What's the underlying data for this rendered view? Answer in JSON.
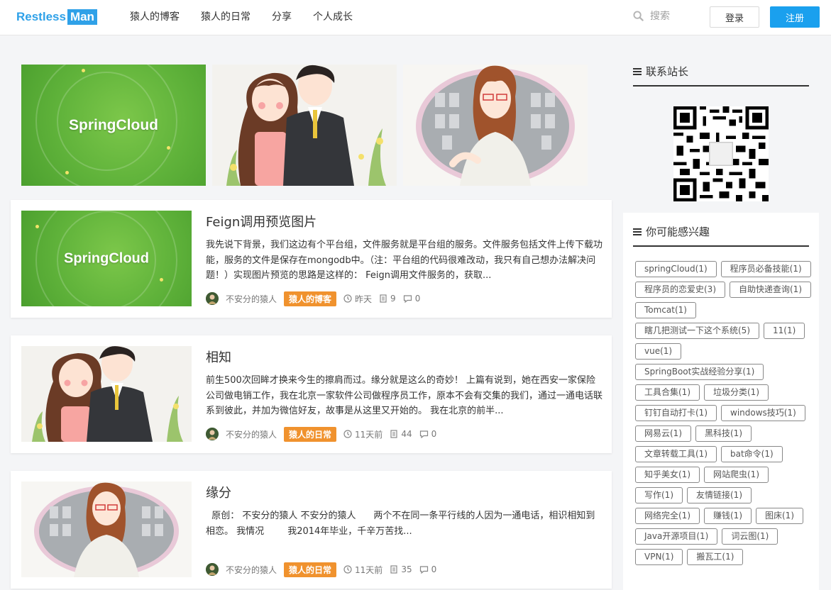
{
  "header": {
    "logo_a": "Restless",
    "logo_b": "Man",
    "nav": [
      "猿人的博客",
      "猿人的日常",
      "分享",
      "个人成长"
    ],
    "search_placeholder": "搜索",
    "login": "登录",
    "register": "注册"
  },
  "banner": {
    "slide1_text": "SpringCloud"
  },
  "posts": [
    {
      "thumb_text": "SpringCloud",
      "title": "Feign调用预览图片",
      "desc": "我先说下背景，我们这边有个平台组，文件服务就是平台组的服务。文件服务包括文件上传下载功能，服务的文件是保存在mongodb中。（注：平台组的代码很难改动，我只有自己想办法解决问题！）实现图片预览的思路是这样的： Feign调用文件服务的，获取...",
      "author": "不安分的猿人",
      "category": "猿人的博客",
      "time": "昨天",
      "views": "9",
      "comments": "0"
    },
    {
      "title": "相知",
      "desc": "前生500次回眸才换来今生的擦肩而过。缘分就是这么的奇妙！ 上篇有说到，她在西安一家保险公司做电销工作，我在北京一家软件公司做程序员工作，原本不会有交集的我们，通过一通电话联系到彼此，并加为微信好友，故事是从这里又开始的。 我在北京的前半...",
      "author": "不安分的猿人",
      "category": "猿人的日常",
      "time": "11天前",
      "views": "44",
      "comments": "0"
    },
    {
      "title": "缘分",
      "desc": "  原创： 不安分的猿人 不安分的猿人      两个不在同一条平行线的人因为一通电话，相识相知到相恋。 我情况        我2014年毕业，千辛万苦找...",
      "author": "不安分的猿人",
      "category": "猿人的日常",
      "time": "11天前",
      "views": "35",
      "comments": "0"
    }
  ],
  "sidebar": {
    "contact_title": "联系站长",
    "interest_title": "你可能感兴趣",
    "tags": [
      "springCloud(1)",
      "程序员必备技能(1)",
      "程序员的恋爱史(3)",
      "自助快递查询(1)",
      "Tomcat(1)",
      "瞎几把测试一下这个系统(5)",
      "11(1)",
      "vue(1)",
      "SpringBoot实战经验分享(1)",
      "工具合集(1)",
      "垃圾分类(1)",
      "钉钉自动打卡(1)",
      "windows技巧(1)",
      "网易云(1)",
      "黑科技(1)",
      "文章转载工具(1)",
      "bat命令(1)",
      "知乎美女(1)",
      "网站爬虫(1)",
      "写作(1)",
      "友情链接(1)",
      "网络完全(1)",
      "赚钱(1)",
      "图床(1)",
      "Java开源项目(1)",
      "词云图(1)",
      "VPN(1)",
      "搬瓦工(1)"
    ]
  },
  "colors": {
    "accent": "#1aa0ee",
    "category_tag": "#f0922e",
    "spring_green": "#5fb23a"
  }
}
